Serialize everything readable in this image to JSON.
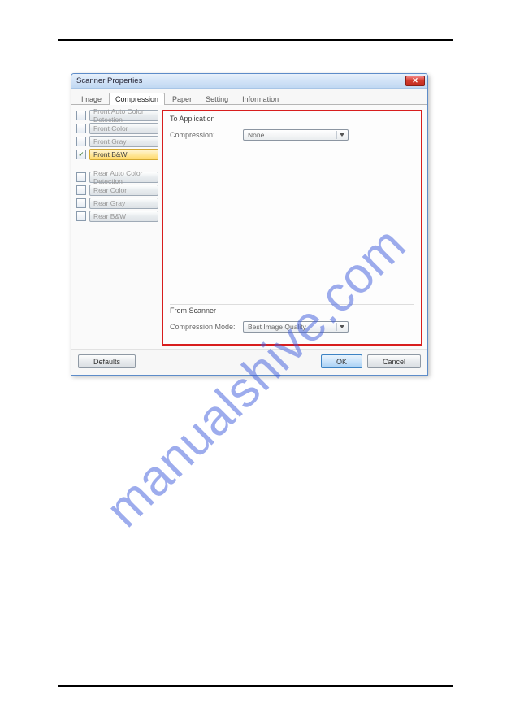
{
  "watermark": "manualshive.com",
  "dialog": {
    "title": "Scanner Properties"
  },
  "tabs": {
    "image": "Image",
    "compression": "Compression",
    "paper": "Paper",
    "setting": "Setting",
    "information": "Information"
  },
  "options": {
    "front_auto": "Front Auto Color Detection",
    "front_color": "Front Color",
    "front_gray": "Front Gray",
    "front_bw": "Front B&W",
    "rear_auto": "Rear Auto Color Detection",
    "rear_color": "Rear Color",
    "rear_gray": "Rear Gray",
    "rear_bw": "Rear B&W"
  },
  "panel": {
    "to_app": "To Application",
    "compression_label": "Compression:",
    "compression_value": "None",
    "from_scanner": "From Scanner",
    "compmode_label": "Compression Mode:",
    "compmode_value": "Best Image Quality"
  },
  "footer": {
    "defaults": "Defaults",
    "ok": "OK",
    "cancel": "Cancel"
  }
}
